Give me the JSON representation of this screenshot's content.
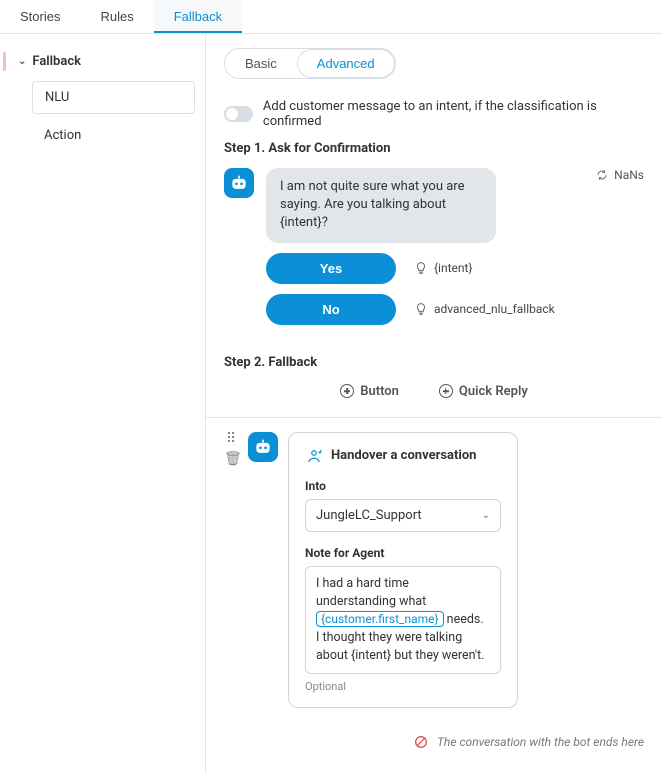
{
  "top_tabs": {
    "stories": "Stories",
    "rules": "Rules",
    "fallback": "Fallback"
  },
  "sidebar": {
    "header": "Fallback",
    "items": [
      "NLU",
      "Action"
    ]
  },
  "seg": {
    "basic": "Basic",
    "advanced": "Advanced"
  },
  "toggle_label": "Add customer message to an intent, if the classification is confirmed",
  "step1": {
    "title": "Step 1. Ask for Confirmation",
    "message": "I am not quite sure what you are saying. Are you talking about {intent}?",
    "meta": "NaNs",
    "yes": "Yes",
    "yes_hint": "{intent}",
    "no": "No",
    "no_hint": "advanced_nlu_fallback"
  },
  "step2": {
    "title": "Step 2. Fallback",
    "action_button": "Button",
    "action_quick": "Quick Reply"
  },
  "card": {
    "title": "Handover a conversation",
    "into_label": "Into",
    "into_value": "JungleLC_Support",
    "note_label": "Note for Agent",
    "note_before": "I had a hard time understanding what ",
    "note_chip": "{customer.first_name}",
    "note_after": " needs. I thought they were talking about {intent} but they weren't.",
    "optional": "Optional"
  },
  "footer": "The conversation with the bot ends here"
}
